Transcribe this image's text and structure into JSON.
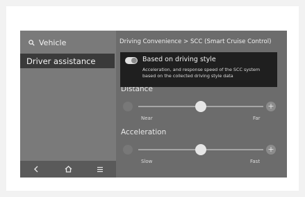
{
  "sidebar": {
    "search_label": "Vehicle",
    "menu_item": "Driver assistance",
    "nav": {
      "back_icon": "back-icon",
      "home_icon": "home-icon",
      "menu_icon": "menu-icon"
    }
  },
  "header": {
    "breadcrumb": "Driving Convenience > SCC (Smart Cruise Control)"
  },
  "popup": {
    "toggle_on": true,
    "title": "Based on driving style",
    "description": "Acceleration, and response speed of the SCC system based on the collected driving style data"
  },
  "settings": {
    "distance": {
      "label": "Distance",
      "min_label": "Near",
      "max_label": "Far",
      "value_fraction": 0.5
    },
    "acceleration": {
      "label": "Acceleration",
      "min_label": "Slow",
      "max_label": "Fast",
      "value_fraction": 0.5
    }
  },
  "colors": {
    "screen_bg": "#6c6c6c",
    "sidebar_bg": "#7a7a7a",
    "selected_bg": "#3a3a3a",
    "popup_bg": "#1f1f1f"
  }
}
